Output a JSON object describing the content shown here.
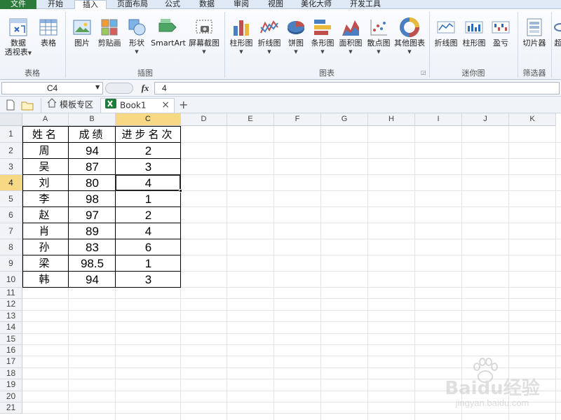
{
  "ribbon_tabs": [
    "文件",
    "开始",
    "插入",
    "页面布局",
    "公式",
    "数据",
    "审阅",
    "视图",
    "美化大师",
    "开发工具"
  ],
  "ribbon": {
    "groups": {
      "table": "表格",
      "illustrations": "插图",
      "charts": "图表",
      "sparklines": "迷你图",
      "filter": "筛选器"
    },
    "buttons": {
      "pivot_line1": "数据",
      "pivot_line2": "透视表",
      "table": "表格",
      "picture": "图片",
      "clipart": "剪贴画",
      "shapes": "形状",
      "smartart": "SmartArt",
      "screenshot": "屏幕截图",
      "column_chart": "柱形图",
      "line_chart": "折线图",
      "pie_chart": "饼图",
      "bar_chart": "条形图",
      "area_chart": "面积图",
      "scatter_chart": "散点图",
      "other_charts": "其他图表",
      "spark_line": "折线图",
      "spark_column": "柱形图",
      "spark_winloss": "盈亏",
      "slicer": "切片器",
      "hyperlink_partial": "超"
    }
  },
  "formula_bar": {
    "name_box": "C4",
    "fx": "fx",
    "value": "4"
  },
  "doc_tabs": {
    "template": "模板专区",
    "book": "Book1",
    "close": "×",
    "add": "+"
  },
  "columns": [
    "A",
    "B",
    "C",
    "D",
    "E",
    "F",
    "G",
    "H",
    "I",
    "J",
    "K"
  ],
  "rows": [
    "1",
    "2",
    "3",
    "4",
    "5",
    "6",
    "7",
    "8",
    "9",
    "10",
    "11",
    "12",
    "13",
    "14",
    "15",
    "16",
    "17",
    "18",
    "19",
    "20",
    "21"
  ],
  "selected_cell": "C4",
  "table": {
    "headers": [
      "姓名",
      "成绩",
      "进步名次"
    ],
    "rows": [
      [
        "周",
        "94",
        "2"
      ],
      [
        "吴",
        "87",
        "3"
      ],
      [
        "刘",
        "80",
        "4"
      ],
      [
        "李",
        "98",
        "1"
      ],
      [
        "赵",
        "97",
        "2"
      ],
      [
        "肖",
        "89",
        "4"
      ],
      [
        "孙",
        "83",
        "6"
      ],
      [
        "梁",
        "98.5",
        "1"
      ],
      [
        "韩",
        "94",
        "3"
      ]
    ]
  },
  "watermark": {
    "brand": "Baidu经验",
    "url": "jingyan.baidu.com"
  },
  "colors": {
    "file_tab": "#2c7a3a",
    "selection_header": "#f7d984",
    "ribbon_bg": "#eef3f9"
  }
}
